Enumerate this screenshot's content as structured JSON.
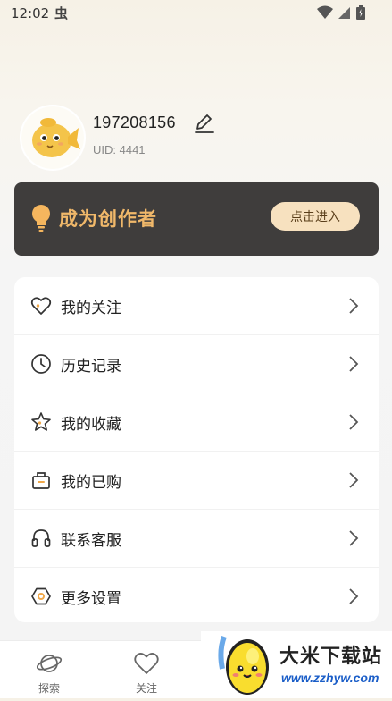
{
  "status_bar": {
    "time": "12:02"
  },
  "profile": {
    "username": "197208156",
    "uid": "UID: 4441"
  },
  "creator_banner": {
    "title": "成为创作者",
    "button_label": "点击进入",
    "accent_color": "#f0b86a"
  },
  "menu": {
    "items": [
      {
        "label": "我的关注",
        "icon": "heart-icon"
      },
      {
        "label": "历史记录",
        "icon": "clock-icon"
      },
      {
        "label": "我的收藏",
        "icon": "star-icon"
      },
      {
        "label": "我的已购",
        "icon": "shopping-bag-icon"
      },
      {
        "label": "联系客服",
        "icon": "headset-icon"
      },
      {
        "label": "更多设置",
        "icon": "settings-icon"
      }
    ]
  },
  "bottom_nav": {
    "items": [
      {
        "label": "探索",
        "icon": "planet-icon"
      },
      {
        "label": "关注",
        "icon": "heart-icon"
      }
    ]
  },
  "watermark": {
    "title": "大米下载站",
    "url": "www.zzhyw.com"
  }
}
